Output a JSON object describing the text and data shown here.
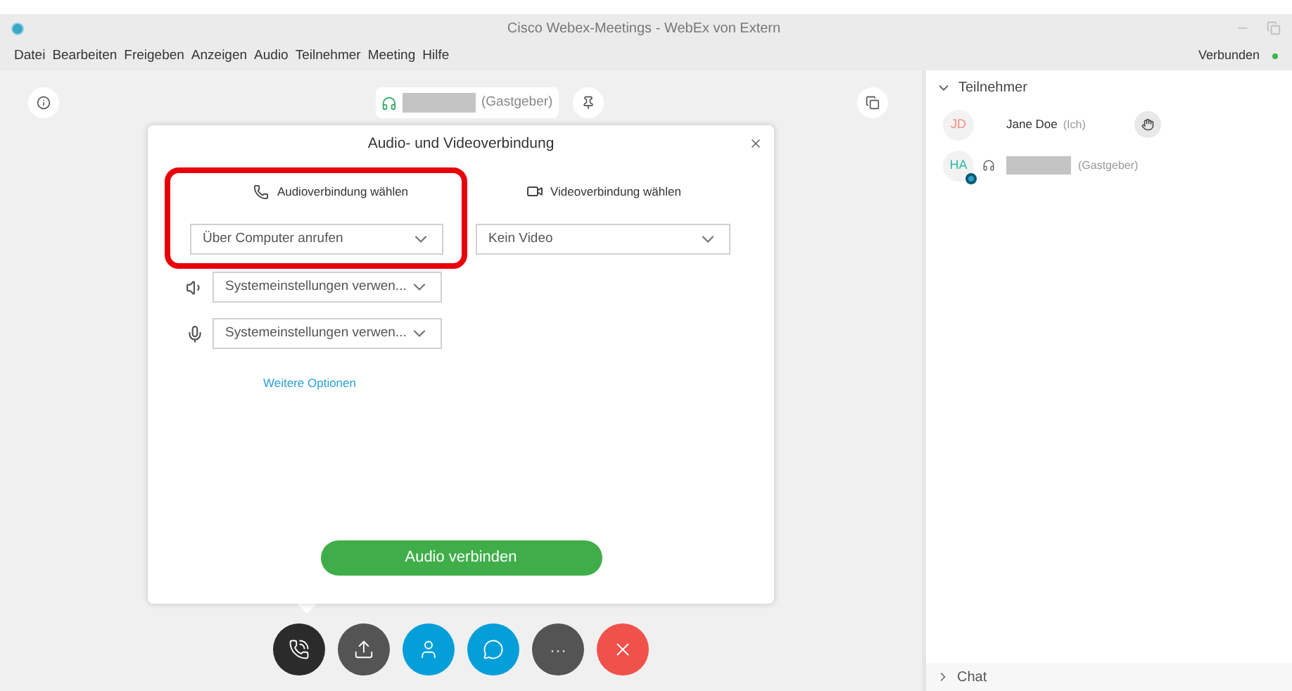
{
  "window": {
    "title": "Cisco Webex-Meetings - WebEx von Extern"
  },
  "menu": [
    "Datei",
    "Bearbeiten",
    "Freigeben",
    "Anzeigen",
    "Audio",
    "Teilnehmer",
    "Meeting",
    "Hilfe"
  ],
  "status": {
    "text": "Verbunden",
    "color": "#3cb44b"
  },
  "host_pill": {
    "role": "(Gastgeber)"
  },
  "dialog": {
    "title": "Audio- und Videoverbindung",
    "audio": {
      "label": "Audioverbindung wählen",
      "value": "Über Computer anrufen",
      "highlighted": true
    },
    "video": {
      "label": "Videoverbindung wählen",
      "value": "Kein Video"
    },
    "speaker": {
      "value": "Systemeinstellungen verwen..."
    },
    "microphone": {
      "value": "Systemeinstellungen verwen..."
    },
    "more_link": "Weitere Optionen",
    "connect_button": "Audio verbinden"
  },
  "toolbar": [
    {
      "kind": "audio",
      "color": "#2b2b2b"
    },
    {
      "kind": "share",
      "color": "#545454"
    },
    {
      "kind": "participants",
      "color": "#049fd9"
    },
    {
      "kind": "chat",
      "color": "#049fd9"
    },
    {
      "kind": "more",
      "color": "#545454",
      "label": "···"
    },
    {
      "kind": "leave",
      "color": "#f0524b"
    }
  ],
  "participants_panel": {
    "title": "Teilnehmer",
    "expanded": true,
    "participants": [
      {
        "initials": "JD",
        "color": "#f08c7d",
        "name": "Jane Doe",
        "tag": "(Ich)",
        "kind": "self"
      },
      {
        "initials": "HA",
        "color": "#2fb8a8",
        "tag": "(Gastgeber)",
        "kind": "host"
      }
    ]
  },
  "chat_panel": {
    "title": "Chat",
    "expanded": false
  }
}
